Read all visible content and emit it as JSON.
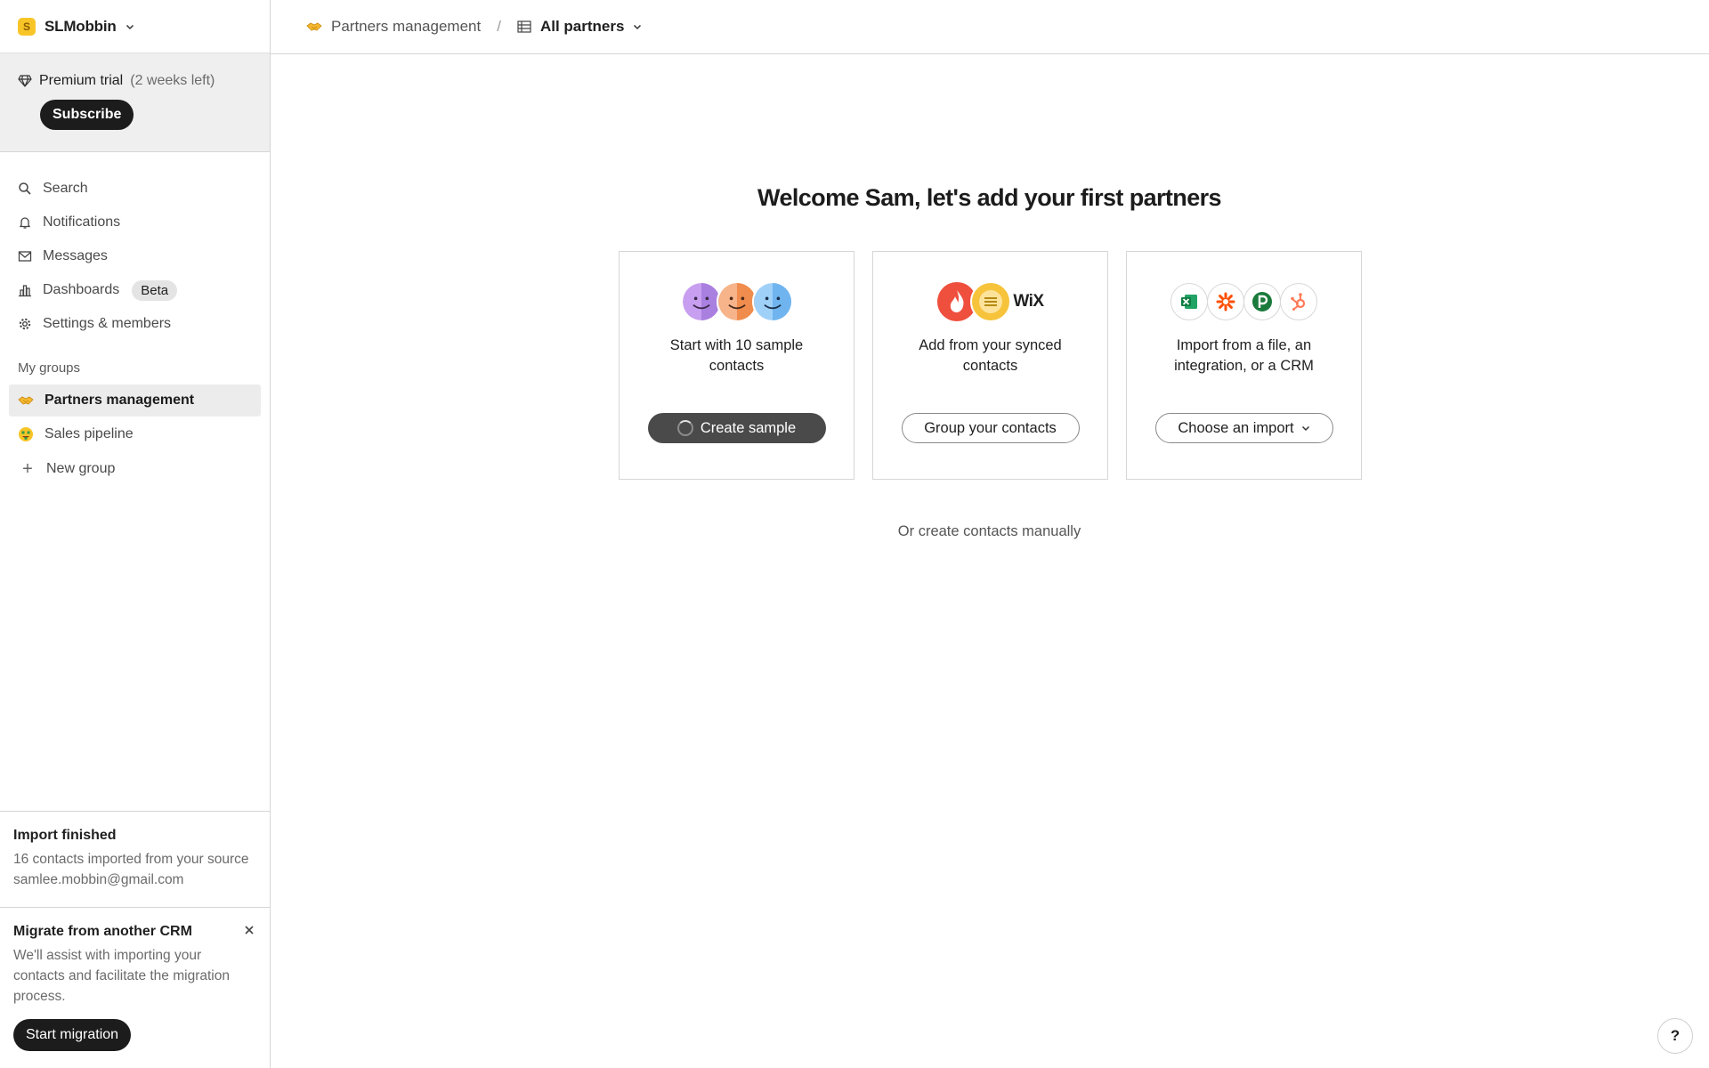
{
  "workspace": {
    "name": "SLMobbin",
    "initial": "S"
  },
  "trial": {
    "label": "Premium trial",
    "remaining": "(2 weeks left)",
    "subscribe_label": "Subscribe"
  },
  "nav": {
    "search": "Search",
    "notifications": "Notifications",
    "messages": "Messages",
    "dashboards": "Dashboards",
    "dashboards_badge": "Beta",
    "settings": "Settings & members"
  },
  "groups": {
    "section_label": "My groups",
    "items": [
      {
        "label": "Partners management",
        "icon": "handshake-emoji",
        "active": true
      },
      {
        "label": "Sales pipeline",
        "icon": "money-face-emoji",
        "active": false
      }
    ],
    "new_group": "New group"
  },
  "import_notice": {
    "title": "Import finished",
    "text": "16 contacts imported from your source samlee.mobbin@gmail.com"
  },
  "migration": {
    "title": "Migrate from another CRM",
    "text": "We'll assist with importing your contacts and facilitate the migration process.",
    "button": "Start migration"
  },
  "topbar": {
    "breadcrumb": "Partners management",
    "separator": "/",
    "view": "All partners"
  },
  "main": {
    "welcome": "Welcome Sam, let's add your first partners",
    "cards": [
      {
        "text": "Start with 10 sample contacts",
        "button": "Create sample"
      },
      {
        "text": "Add from your synced contacts",
        "button": "Group your contacts",
        "brand": "WiX"
      },
      {
        "text": "Import from a file, an integration, or a CRM",
        "button": "Choose an import"
      }
    ],
    "manual_link": "Or create contacts manually"
  },
  "help": {
    "label": "?"
  },
  "colors": {
    "accent_dark": "#1c1c1c",
    "workspace_yellow": "#f7c528",
    "sidebar_trial_bg": "#efefef"
  }
}
